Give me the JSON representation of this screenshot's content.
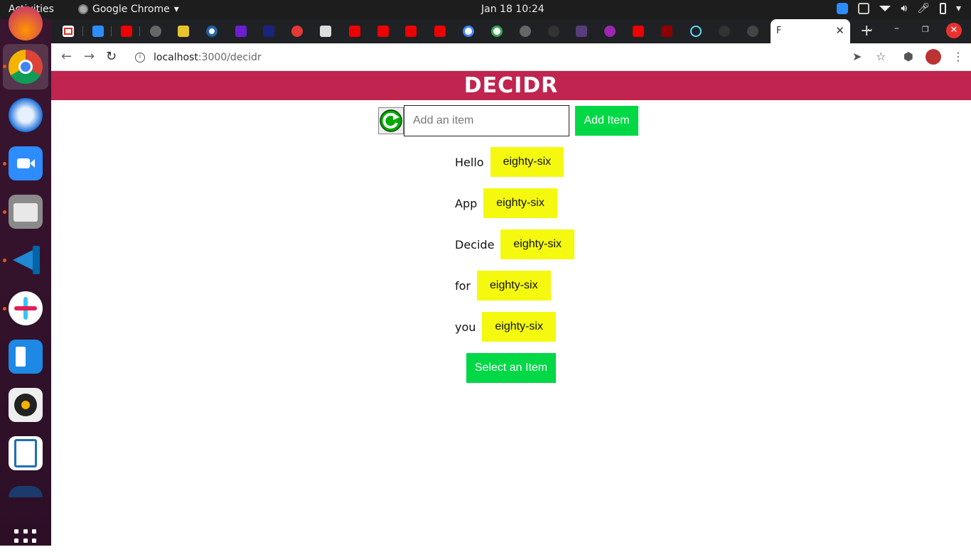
{
  "system": {
    "activities": "Activities",
    "app_menu": "Google Chrome",
    "clock": "Jan 18  10:24"
  },
  "browser": {
    "active_tab_title": "F",
    "url_host": "localhost",
    "url_path": ":3000/decidr"
  },
  "app": {
    "title": "DECIDR",
    "input_placeholder": "Add an item",
    "add_button": "Add Item",
    "items": [
      {
        "label": "Hello",
        "delete": "eighty-six"
      },
      {
        "label": "App",
        "delete": "eighty-six"
      },
      {
        "label": "Decide",
        "delete": "eighty-six"
      },
      {
        "label": "for",
        "delete": "eighty-six"
      },
      {
        "label": "you",
        "delete": "eighty-six"
      }
    ],
    "select_button": "Select an Item"
  },
  "colors": {
    "header": "#c0244f",
    "green": "#00d846",
    "yellow": "#f4f90f"
  }
}
